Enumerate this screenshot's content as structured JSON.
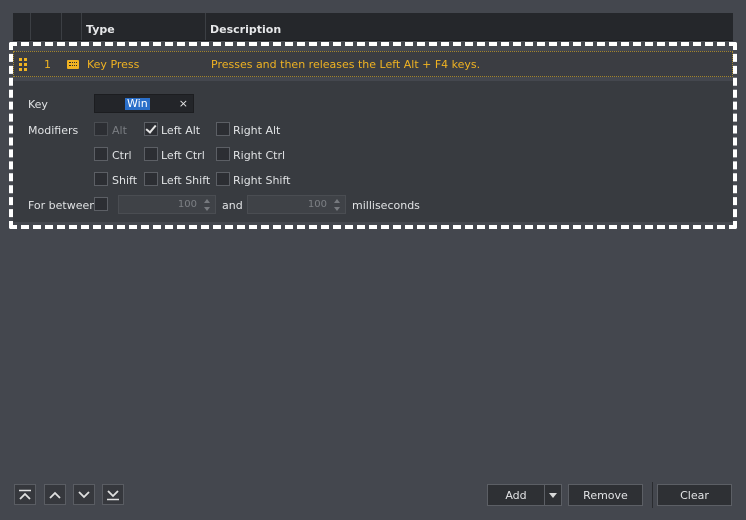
{
  "table": {
    "headers": [
      "",
      "",
      "",
      "Type",
      "Description"
    ],
    "row": {
      "index": "1",
      "icon": "keyboard-icon",
      "type": "Key Press",
      "description": "Presses and then releases the Left Alt + F4 keys."
    }
  },
  "details": {
    "key_label": "Key",
    "key_value": "Win",
    "key_clear": "×",
    "modifiers_label": "Modifiers",
    "modifiers": {
      "alt": {
        "label": "Alt",
        "checked": false,
        "enabled": false
      },
      "left_alt": {
        "label": "Left Alt",
        "checked": true
      },
      "right_alt": {
        "label": "Right Alt",
        "checked": false
      },
      "ctrl": {
        "label": "Ctrl",
        "checked": false
      },
      "left_ctrl": {
        "label": "Left Ctrl",
        "checked": false
      },
      "right_ctrl": {
        "label": "Right Ctrl",
        "checked": false
      },
      "shift": {
        "label": "Shift",
        "checked": false
      },
      "left_shift": {
        "label": "Left Shift",
        "checked": false
      },
      "right_shift": {
        "label": "Right Shift",
        "checked": false
      }
    },
    "for_between_label": "For between",
    "for_between_checked": false,
    "min_ms": "100",
    "and_label": "and",
    "max_ms": "100",
    "ms_label": "milliseconds"
  },
  "toolbar": {
    "add_label": "Add",
    "remove_label": "Remove",
    "clear_label": "Clear"
  },
  "colors": {
    "accent": "#f0b322",
    "background": "#44474e",
    "panel": "#383b40",
    "selection": "#2b6fc9"
  }
}
